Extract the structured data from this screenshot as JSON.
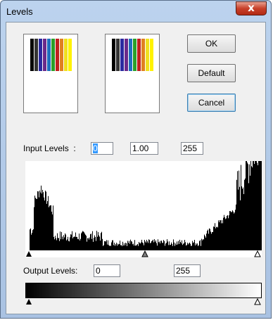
{
  "window": {
    "title": "Levels",
    "close_glyph": "x"
  },
  "buttons": {
    "ok": "OK",
    "default": "Default",
    "cancel": "Cancel"
  },
  "input_levels": {
    "label": "Input Levels  :",
    "black": "0",
    "gamma": "1.00",
    "white": "255",
    "black_selected": true
  },
  "output_levels": {
    "label": "Output Levels:",
    "black": "0",
    "white": "255"
  },
  "histogram": {
    "range_min": 0,
    "range_max": 255,
    "gamma_marker": 1.0
  },
  "icons": {
    "close": "close-icon",
    "marker": "triangle-marker-icon"
  }
}
